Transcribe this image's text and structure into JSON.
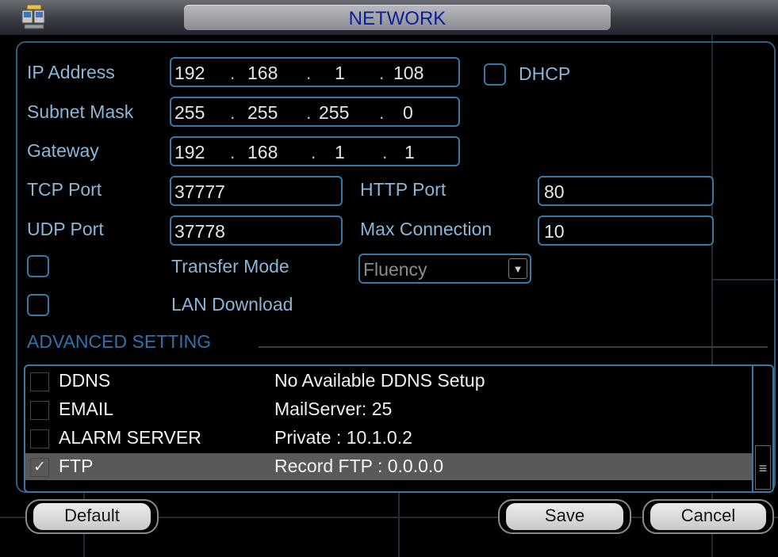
{
  "title": "NETWORK",
  "icons": {
    "app": "network-settings-icon",
    "dropdown": "chevron-down-icon",
    "check": "checkmark-icon",
    "scroll": "grip-lines-icon"
  },
  "colors": {
    "label": "#8ab6d8",
    "border": "#3779a6",
    "title_text": "#0b1f9c",
    "section_title": "#2f72a8",
    "selected_row": "#595959"
  },
  "form": {
    "ip_address": {
      "label": "IP Address",
      "octets": [
        "192",
        "168",
        "1",
        "108"
      ]
    },
    "dhcp": {
      "label": "DHCP",
      "checked": false
    },
    "subnet_mask": {
      "label": "Subnet Mask",
      "octets": [
        "255",
        "255",
        "255",
        "0"
      ]
    },
    "gateway": {
      "label": "Gateway",
      "octets": [
        "192",
        "168",
        "1",
        "1"
      ]
    },
    "tcp_port": {
      "label": "TCP Port",
      "value": "37777"
    },
    "http_port": {
      "label": "HTTP Port",
      "value": "80"
    },
    "udp_port": {
      "label": "UDP Port",
      "value": "37778"
    },
    "max_connection": {
      "label": "Max Connection",
      "value": "10"
    },
    "transfer_mode": {
      "label": "Transfer Mode",
      "checked": false,
      "selected": "Fluency"
    },
    "lan_download": {
      "label": "LAN Download",
      "checked": false
    }
  },
  "advanced": {
    "title": "ADVANCED SETTING",
    "rows": [
      {
        "name": "DDNS",
        "desc": "No Available DDNS Setup",
        "checked": false,
        "selected": false
      },
      {
        "name": "EMAIL",
        "desc": "MailServer: 25",
        "checked": false,
        "selected": false
      },
      {
        "name": "ALARM SERVER",
        "desc": "Private : 10.1.0.2",
        "checked": false,
        "selected": false
      },
      {
        "name": "FTP",
        "desc": "Record FTP : 0.0.0.0",
        "checked": true,
        "selected": true
      }
    ]
  },
  "buttons": {
    "default": "Default",
    "save": "Save",
    "cancel": "Cancel"
  }
}
